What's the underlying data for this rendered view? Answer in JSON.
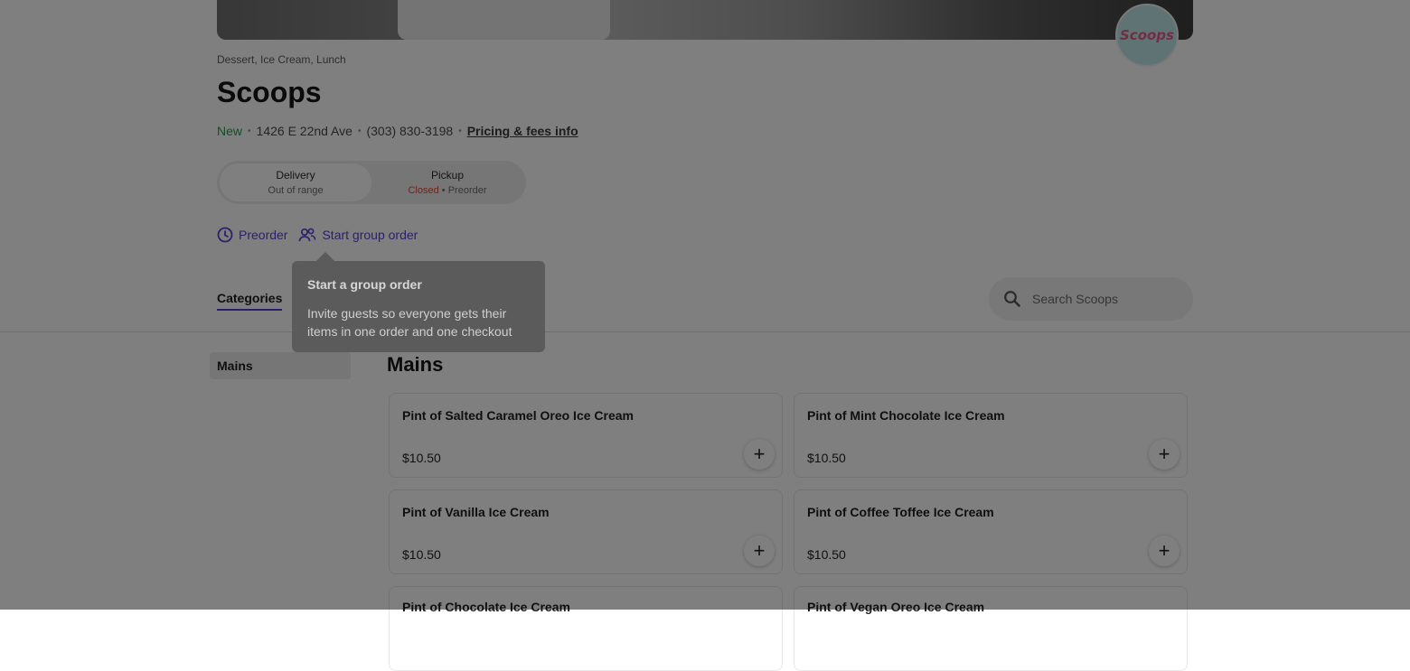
{
  "store": {
    "categories": "Dessert, Ice Cream, Lunch",
    "name": "Scoops",
    "logo_text": "Scoops",
    "status": "New",
    "address": "1426 E 22nd Ave",
    "phone": "(303) 830-3198",
    "fees_link": "Pricing & fees info"
  },
  "mode_toggle": {
    "delivery": {
      "label": "Delivery",
      "sub": "Out of range"
    },
    "pickup": {
      "label": "Pickup",
      "status": "Closed",
      "sub": "Preorder"
    }
  },
  "actions": {
    "preorder": "Preorder",
    "group_order": "Start group order"
  },
  "tabs": {
    "categories": "Categories"
  },
  "search": {
    "placeholder": "Search Scoops"
  },
  "sidebar": {
    "items": [
      {
        "label": "Mains"
      }
    ]
  },
  "menu": {
    "section_title": "Mains",
    "items": [
      {
        "name": "Pint of Salted Caramel Oreo Ice Cream",
        "price": "$10.50"
      },
      {
        "name": "Pint of Mint Chocolate Ice Cream",
        "price": "$10.50"
      },
      {
        "name": "Pint of Vanilla Ice Cream",
        "price": "$10.50"
      },
      {
        "name": "Pint of Coffee Toffee Ice Cream",
        "price": "$10.50"
      },
      {
        "name": "Pint of Chocolate Ice Cream",
        "price": ""
      },
      {
        "name": "Pint of Vegan Oreo Ice Cream",
        "price": ""
      }
    ],
    "add_icon": "plus-icon"
  },
  "tooltip": {
    "title": "Start a group order",
    "body": "Invite guests so everyone gets their items in one order and one checkout"
  },
  "colors": {
    "accent": "#5a40d6",
    "new": "#1f9f4c",
    "closed": "#d54a3a"
  }
}
